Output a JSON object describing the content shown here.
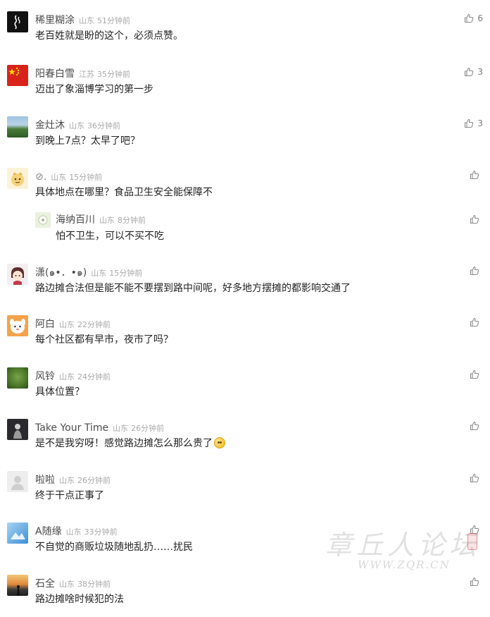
{
  "comments": [
    {
      "username": "稀里糊涂",
      "region": "山东",
      "time": "51分钟前",
      "text": "老百姓就是盼的这个，必须点赞。",
      "likes": "6"
    },
    {
      "username": "阳春白雪",
      "region": "江苏",
      "time": "35分钟前",
      "text": "迈出了象淄博学习的第一步",
      "likes": "3"
    },
    {
      "username": "金灶沐",
      "region": "山东",
      "time": "36分钟前",
      "text": "到晚上7点？太早了吧？",
      "likes": "3"
    },
    {
      "username": "⊘.",
      "region": "山东",
      "time": "15分钟前",
      "text": "具体地点在哪里？食品卫生安全能保障不",
      "likes": "",
      "replies": [
        {
          "username": "海纳百川",
          "region": "山东",
          "time": "8分钟前",
          "text": "怕不卫生，可以不买不吃",
          "likes": ""
        }
      ]
    },
    {
      "username": "潇(๑•．•๑)",
      "region": "山东",
      "time": "15分钟前",
      "text": "路边摊合法但是能不能不要摆到路中间呢，好多地方摆摊的都影响交通了",
      "likes": ""
    },
    {
      "username": "阿白",
      "region": "山东",
      "time": "22分钟前",
      "text": "每个社区都有早市，夜市了吗？",
      "likes": ""
    },
    {
      "username": "风铃",
      "region": "山东",
      "time": "24分钟前",
      "text": "具体位置？",
      "likes": ""
    },
    {
      "username": "Take Your Time",
      "region": "山东",
      "time": "26分钟前",
      "text": "是不是我穷呀！感觉路边摊怎么那么贵了",
      "likes": "",
      "emoji": "embarrassed-emoji"
    },
    {
      "username": "啦啦",
      "region": "山东",
      "time": "26分钟前",
      "text": "终于干点正事了",
      "likes": ""
    },
    {
      "username": "A随缘",
      "region": "山东",
      "time": "33分钟前",
      "text": "不自觉的商贩垃圾随地乱扔……扰民",
      "likes": ""
    },
    {
      "username": "石全",
      "region": "山东",
      "time": "38分钟前",
      "text": "路边摊啥时候犯的法",
      "likes": ""
    }
  ],
  "watermark": {
    "text": "章丘人论坛",
    "url": "WWW.ZQR.CN"
  },
  "icons": {
    "like": "thumbs-up-icon"
  },
  "colors": {
    "username": "#4a4a4a",
    "meta": "#a8a8a8",
    "text": "#222222",
    "like": "#7a7a7a"
  }
}
